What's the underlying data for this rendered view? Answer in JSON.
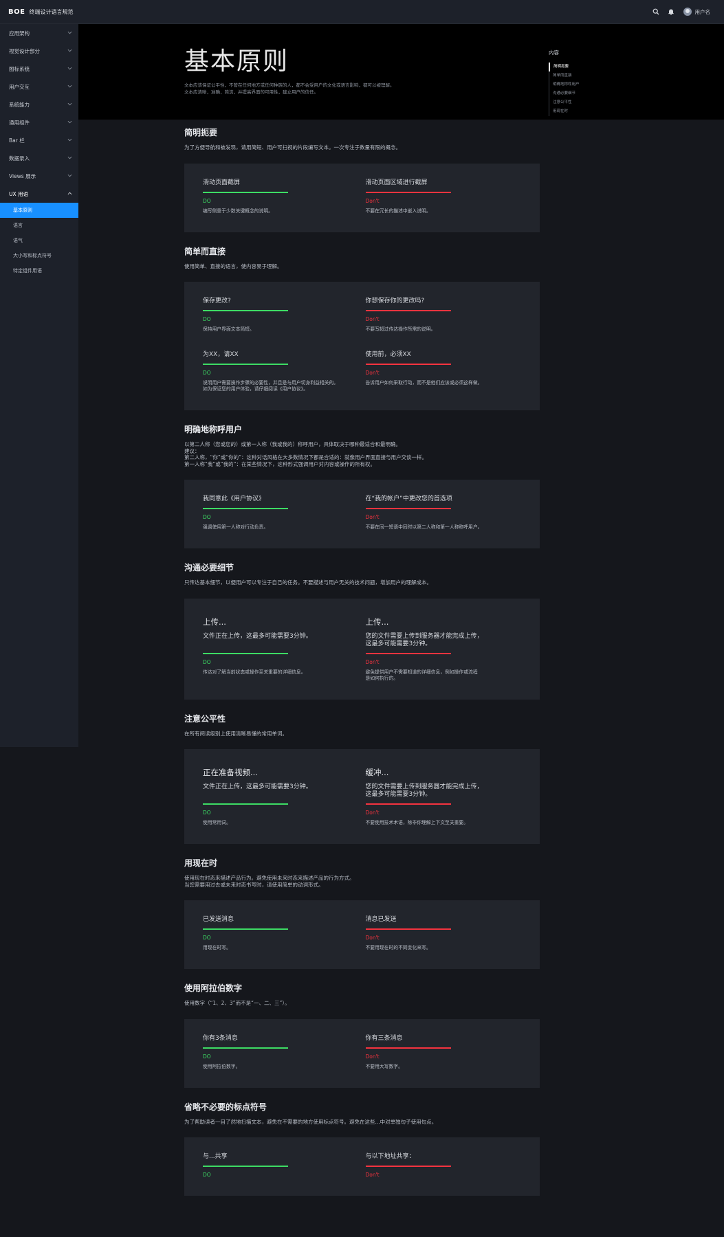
{
  "topbar": {
    "logo": "BOE",
    "title": "终端设计语言规范",
    "username": "用户名"
  },
  "sidebar": {
    "items": [
      {
        "label": "应用架构"
      },
      {
        "label": "视觉设计部分"
      },
      {
        "label": "图标系统"
      },
      {
        "label": "用户交互"
      },
      {
        "label": "系统能力"
      },
      {
        "label": "通用组件"
      },
      {
        "label": "Bar 栏"
      },
      {
        "label": "数据录入"
      },
      {
        "label": "Views 展示"
      },
      {
        "label": "UX 用语"
      }
    ],
    "sub_items": [
      {
        "label": "基本原则"
      },
      {
        "label": "语言"
      },
      {
        "label": "语气"
      },
      {
        "label": "大小写和标点符号"
      },
      {
        "label": "特定组件用语"
      }
    ]
  },
  "hero": {
    "title": "基本原则",
    "desc_line1": "文本应该保证公平性，不管在任何地方或任何种族的人，都不会受用户的文化或语言影响，都可以被理解。",
    "desc_line2": "文本应清晰，准确，简洁，并提高界面的可用性，建立用户的信任。"
  },
  "toc": {
    "title": "内容",
    "items": [
      {
        "label": "简明扼要"
      },
      {
        "label": "简单而直接"
      },
      {
        "label": "明确地称呼用户"
      },
      {
        "label": "沟通必要细节"
      },
      {
        "label": "注意公平性"
      },
      {
        "label": "用现在时"
      }
    ]
  },
  "sections": [
    {
      "title": "简明扼要",
      "desc": "为了方便导航和被发现，请用简短、用户可扫视的片段编写文本。一次专注于数量有限的概念。",
      "do": {
        "title": "滑动页面截屏",
        "tag": "DO",
        "note": "编写侧重于少数关键概念的说明。"
      },
      "dont": {
        "title": "滑动页面区域进行截屏",
        "tag": "Don't",
        "note": "不要在冗长的描述中嵌入说明。"
      }
    },
    {
      "title": "简单而直接",
      "desc": "使用简单、直接的语言，使内容易于理解。",
      "rows": [
        {
          "do": {
            "title": "保存更改?",
            "tag": "DO",
            "note": "保持用户界面文本简短。"
          },
          "dont": {
            "title": "你想保存你的更改吗?",
            "tag": "Don't",
            "note": "不要写超过传达操作所需的说明。"
          }
        },
        {
          "do": {
            "title": "为XX，请XX",
            "tag": "DO",
            "note1": "说明用户需要操作步骤的必要性，并且是与用户切身利益相关的。",
            "note2": "如为保证您的用户体验，请仔细阅读《用户协议》。"
          },
          "dont": {
            "title": "使用前，必须XX",
            "tag": "Don't",
            "note": "告诉用户如何采取行动，而不是他们应该或必须这样做。"
          }
        }
      ]
    },
    {
      "title": "明确地称呼用户",
      "desc1": "以第二人称（您或您的）或第一人称（我或我的）称呼用户，具体取决于哪种最适合和最明确。",
      "desc2": "建议：",
      "desc3": "第二人称，“你”或“你的”：这种对话风格在大多数情况下都是合适的：就像用户界面直接与用户交谈一样。",
      "desc4": "第一人称“我”或“我的”：在某些情况下，这种形式强调用户对内容或操作的所有权。",
      "do": {
        "title": "我同意此《用户协议》",
        "tag": "DO",
        "note": "强调使用第一人称对行动负责。"
      },
      "dont": {
        "title": "在“我的帐户”中更改您的首选项",
        "tag": "Don't",
        "note": "不要在同一短语中同时以第二人称和第一人称称呼用户。"
      }
    },
    {
      "title": "沟通必要细节",
      "desc": "只传达基本细节，以便用户可以专注于自己的任务。不要描述与用户无关的技术问题，增加用户的理解成本。",
      "do": {
        "title": "上传...",
        "sub": "文件正在上传，这最多可能需要3分钟。",
        "tag": "DO",
        "note": "传达对了解当前状态或操作至关重要的详细信息。"
      },
      "dont": {
        "title": "上传...",
        "sub1": "您的文件需要上传到服务器才能完成上传，",
        "sub2": "这最多可能需要3分钟。",
        "tag": "Don't",
        "note1": "避免提供用户不需要知道的详细信息，例如操作或流程",
        "note2": "是如何执行的。"
      }
    },
    {
      "title": "注意公平性",
      "desc": "在所有阅读级别上使用清晰易懂的常用单词。",
      "do": {
        "title": "正在准备视频...",
        "sub": "文件正在上传，这最多可能需要3分钟。",
        "tag": "DO",
        "note": "使用常用词。"
      },
      "dont": {
        "title": "缓冲...",
        "sub1": "您的文件需要上传到服务器才能完成上传，",
        "sub2": "这最多可能需要3分钟。",
        "tag": "Don't",
        "note": "不要使用技术术语，除非你理解上下文至关重要。"
      }
    },
    {
      "title": "用现在时",
      "desc1": "使用现在时态来描述产品行为。避免使用未来时态来描述产品的行为方式。",
      "desc2": "当您需要用过去或未来时态书写时，请使用简单的动词形式。",
      "do": {
        "title": "已发送消息",
        "tag": "DO",
        "note": "用现在时写。"
      },
      "dont": {
        "title": "消息已发送",
        "tag": "Don't",
        "note": "不要用现在时的不同变化来写。"
      }
    },
    {
      "title": "使用阿拉伯数字",
      "desc": "使用数字（“1、2、3”而不是“一、二、三”）。",
      "do": {
        "title": "你有3条消息",
        "tag": "DO",
        "note": "使用阿拉伯数字。"
      },
      "dont": {
        "title": "你有三条消息",
        "tag": "Don't",
        "note": "不要用大写数字。"
      }
    },
    {
      "title": "省略不必要的标点符号",
      "desc": "为了帮助读者一目了然地扫描文本，避免在不需要的地方使用标点符号。避免在这些...中对单独句子使用句点。",
      "do": {
        "title": "与...共享",
        "tag": "DO"
      },
      "dont": {
        "title": "与以下地址共享：",
        "tag": "Don't"
      }
    }
  ]
}
